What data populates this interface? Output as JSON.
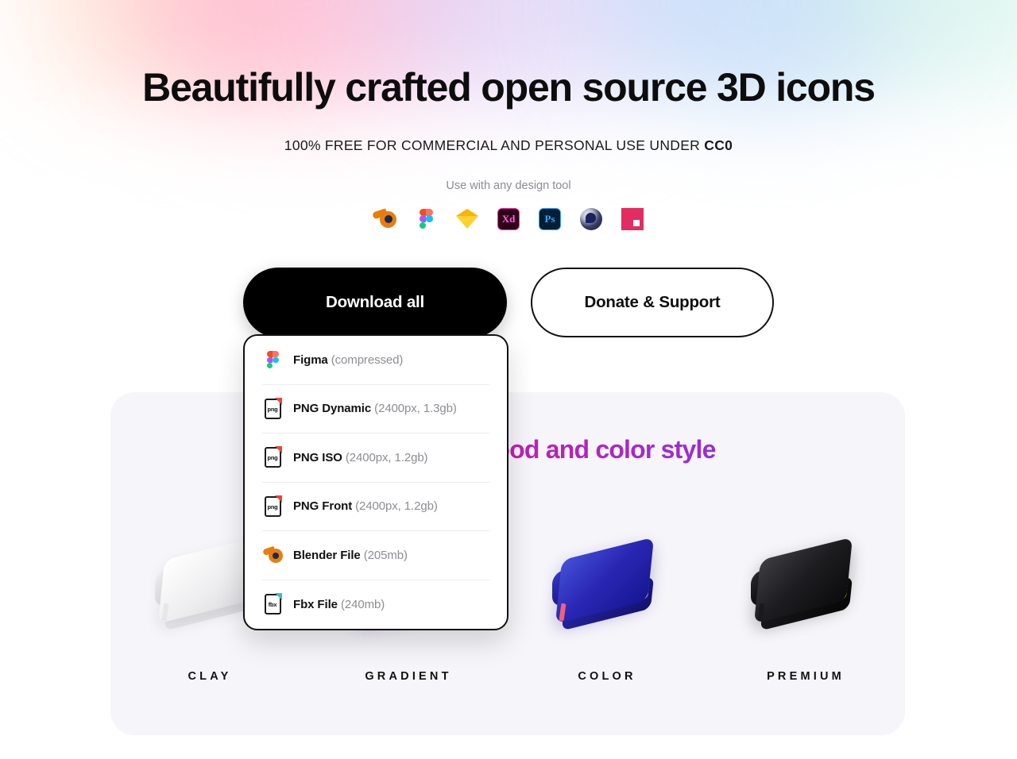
{
  "hero": {
    "title": "Beautifully crafted open source 3D icons",
    "subtitle_prefix": "100% FREE FOR COMMERCIAL AND PERSONAL USE UNDER ",
    "subtitle_license": "CC0",
    "tools_caption": "Use with any design tool",
    "tools": [
      {
        "name": "blender",
        "label": "Blender"
      },
      {
        "name": "figma",
        "label": "Figma"
      },
      {
        "name": "sketch",
        "label": "Sketch"
      },
      {
        "name": "adobe-xd",
        "label": "Xd"
      },
      {
        "name": "photoshop",
        "label": "Ps"
      },
      {
        "name": "cinema-4d",
        "label": "Cinema 4D"
      },
      {
        "name": "invision",
        "label": "InVision"
      }
    ]
  },
  "cta": {
    "primary_label": "Download all",
    "secondary_label": "Donate & Support"
  },
  "dropdown": {
    "items": [
      {
        "icon": "figma-icon",
        "name": "Figma",
        "detail": " (compressed)"
      },
      {
        "icon": "png-file-icon",
        "name": "PNG Dynamic",
        "detail": " (2400px, 1.3gb)"
      },
      {
        "icon": "png-file-icon",
        "name": "PNG ISO",
        "detail": " (2400px, 1.2gb)"
      },
      {
        "icon": "png-file-icon",
        "name": "PNG Front",
        "detail": " (2400px, 1.2gb)"
      },
      {
        "icon": "blender-icon",
        "name": "Blender File",
        "detail": " (205mb)"
      },
      {
        "icon": "fbx-file-icon",
        "name": "Fbx File",
        "detail": " (240mb)"
      }
    ],
    "file_labels": {
      "png": "png",
      "fbx": "fbx"
    }
  },
  "showcase": {
    "title": "Find your best mood and color style",
    "styles": [
      {
        "label": "CLAY",
        "book": "clay"
      },
      {
        "label": "GRADIENT",
        "book": "gradient"
      },
      {
        "label": "COLOR",
        "book": "color"
      },
      {
        "label": "PREMIUM",
        "book": "premium"
      }
    ]
  },
  "colors": {
    "accent_start": "#e0146e",
    "accent_end": "#6d3cf0",
    "panel_bg": "#f6f5fa",
    "primary_button": "#000000"
  }
}
